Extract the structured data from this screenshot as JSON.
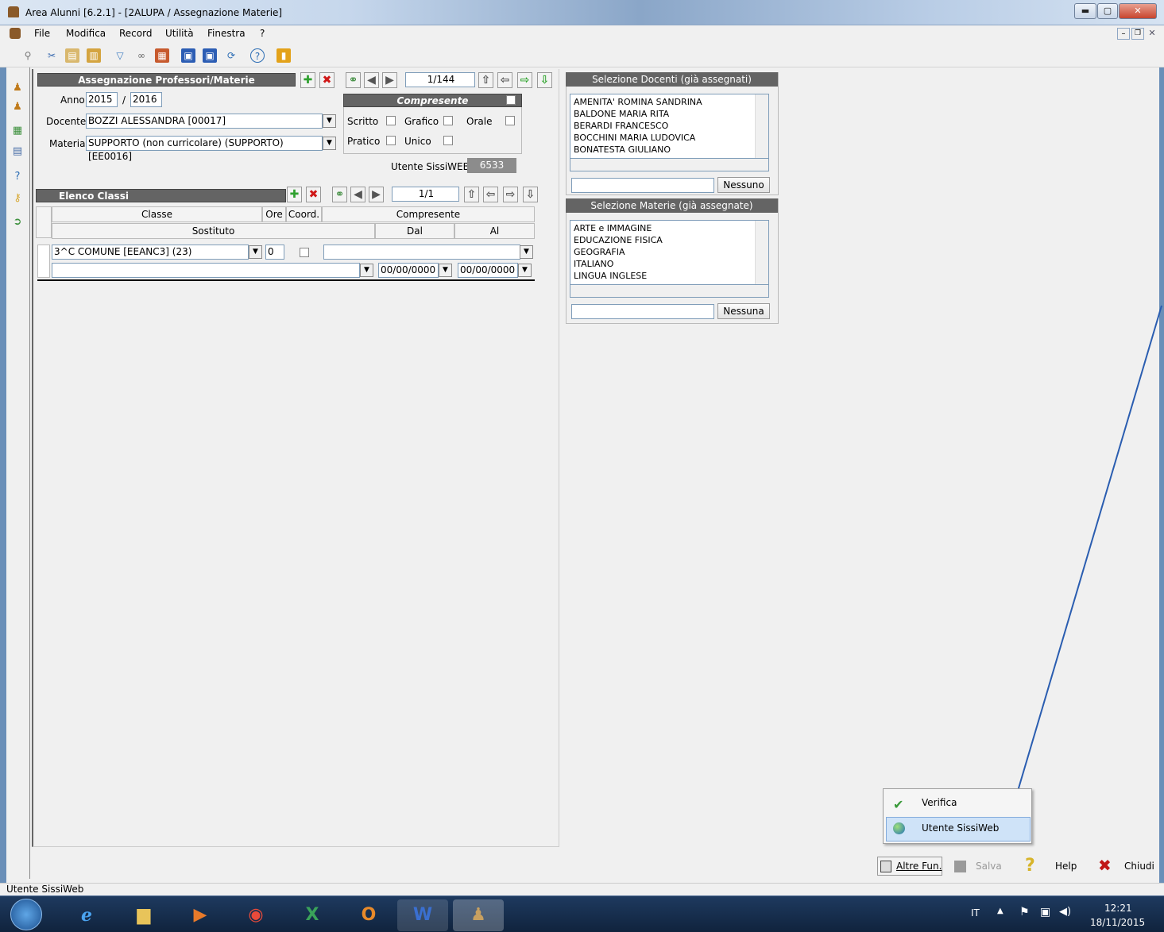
{
  "window": {
    "title": "Area Alunni [6.2.1] - [2ALUPA / Assegnazione Materie]"
  },
  "menu": [
    "File",
    "Modifica",
    "Record",
    "Utilità",
    "Finestra",
    "?"
  ],
  "form": {
    "header": "Assegnazione Professori/Materie",
    "record_pos": "1/144",
    "anno_label": "Anno",
    "anno_from": "2015",
    "anno_sep": "/",
    "anno_to": "2016",
    "docente_label": "Docente",
    "docente_value": "BOZZI ALESSANDRA [00017]",
    "materia_label": "Materia",
    "materia_value": "SUPPORTO (non curricolare) (SUPPORTO) [EE0016]",
    "compresente_label": "Compresente",
    "scritto": "Scritto",
    "grafico": "Grafico",
    "orale": "Orale",
    "pratico": "Pratico",
    "unico": "Unico",
    "utente_label": "Utente SissiWEB",
    "utente_value": "6533"
  },
  "classi": {
    "header": "Elenco Classi",
    "record_pos": "1/1",
    "col_classe": "Classe",
    "col_ore": "Ore",
    "col_coord": "Coord.",
    "col_compresente": "Compresente",
    "col_sostituto": "Sostituto",
    "col_dal": "Dal",
    "col_al": "Al",
    "row_classe": "3^C COMUNE [EEANC3] (23)",
    "row_ore": "0",
    "row_dal": "00/00/0000",
    "row_al": "00/00/0000"
  },
  "docenti": {
    "header": "Selezione Docenti (già assegnati)",
    "items": [
      "AMENITA' ROMINA SANDRINA",
      "BALDONE MARIA RITA",
      "BERARDI FRANCESCO",
      "BOCCHINI MARIA LUDOVICA",
      "BONATESTA GIULIANO"
    ],
    "button": "Nessuno"
  },
  "materie": {
    "header": "Selezione Materie (già assegnate)",
    "items": [
      "ARTE e IMMAGINE",
      "EDUCAZIONE FISICA",
      "GEOGRAFIA",
      "ITALIANO",
      "LINGUA INGLESE"
    ],
    "button": "Nessuna"
  },
  "popup": {
    "verifica": "Verifica",
    "utente": "Utente SissiWeb"
  },
  "buttons": {
    "altre": "Altre Fun.",
    "salva": "Salva",
    "help": "Help",
    "chiudi": "Chiudi"
  },
  "statusbar": "Utente SissiWeb",
  "tray": {
    "lang": "IT",
    "time": "12:21",
    "date": "18/11/2015"
  },
  "colors": {
    "header_bg": "#646464",
    "arrow": "#2a5db0",
    "taskbar": "#1e3a5f"
  }
}
